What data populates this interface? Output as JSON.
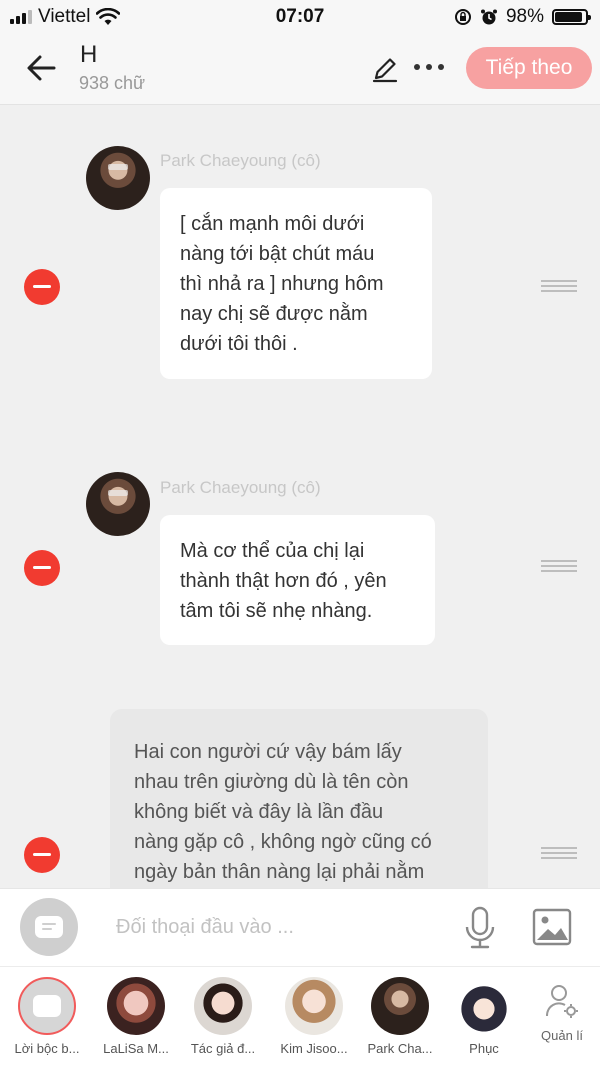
{
  "status_bar": {
    "carrier": "Viettel",
    "time": "07:07",
    "battery": "98%",
    "battery_level": 0.98
  },
  "header": {
    "title": "H",
    "subtitle": "938 chữ",
    "next_label": "Tiếp theo"
  },
  "messages": [
    {
      "type": "character",
      "name": "Park Chaeyoung (cô)",
      "lines": [
        "[ cắn mạnh môi dưới",
        "nàng tới bật chút máu",
        "thì nhả ra ] nhưng hôm",
        "nay chị sẽ được nằm",
        "dưới tôi thôi ."
      ]
    },
    {
      "type": "character",
      "name": "Park Chaeyoung (cô)",
      "lines": [
        "Mà cơ thể của chị lại",
        "thành thật hơn đó , yên",
        "tâm tôi sẽ nhẹ nhàng."
      ]
    },
    {
      "type": "narration",
      "lines": [
        "Hai con người cứ vậy bám lấy",
        "nhau trên giường  dù là tên còn",
        "không biết và đây là lần đầu",
        "nàng gặp cô , không ngờ cũng có",
        "ngày bản thân nàng lại phải nằm"
      ]
    }
  ],
  "input": {
    "placeholder": "Đối thoại đầu vào ..."
  },
  "characters": [
    {
      "label": "Lời bộc b..."
    },
    {
      "label": "LaLiSa M..."
    },
    {
      "label": "Tác giả đ..."
    },
    {
      "label": "Kim Jisoo..."
    },
    {
      "label": "Park Cha..."
    },
    {
      "label": "Phục"
    }
  ],
  "manage_label": "Quản lí",
  "colors": {
    "accent": "#f7a1a1",
    "delete": "#f13b30"
  },
  "icons": [
    "back-arrow-icon",
    "edit-pencil-icon",
    "more-dots-icon",
    "minus-circle-icon",
    "drag-handle-icon",
    "chat-bubble-icon",
    "microphone-icon",
    "image-icon",
    "person-settings-icon"
  ]
}
